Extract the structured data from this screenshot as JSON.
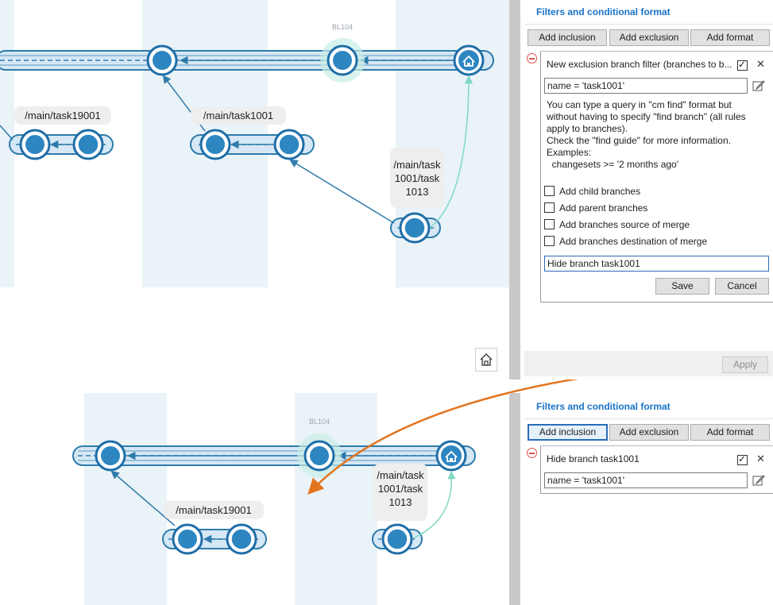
{
  "colors": {
    "accent": "#1a73c8",
    "node": "#2e86c1",
    "node_dark": "#1f6ea8",
    "lane": "#eaf3f8",
    "callout_arrow": "#e3741e",
    "merge_line": "#8fe0cf"
  },
  "graph_top": {
    "label_bl": "BL104",
    "branch_labels": [
      "/main/task19001",
      "/main/task1001",
      "/main/task\n1001/task\n1013"
    ]
  },
  "graph_bottom": {
    "label_bl": "BL104",
    "branch_labels": [
      "/main/task19001",
      "/main/task\n1001/task\n1013"
    ]
  },
  "panel_top": {
    "title": "Filters and conditional format",
    "buttons": {
      "inclusion": "Add inclusion",
      "exclusion": "Add exclusion",
      "format": "Add format"
    },
    "filter": {
      "header": "New exclusion branch filter (branches to b...",
      "query": "name = 'task1001'",
      "help_lines": [
        "You can type a query in \"cm find\" format but",
        "without having to specify \"find branch\" (all rules",
        "apply to branches).",
        "Check the \"find guide\" for more information.",
        "Examples:",
        "  changesets >= '2 months ago'"
      ],
      "options": [
        "Add child branches",
        "Add parent branches",
        "Add branches source of merge",
        "Add branches destination of merge"
      ],
      "name_value": "Hide branch task1001",
      "save": "Save",
      "cancel": "Cancel"
    },
    "apply": "Apply"
  },
  "panel_bottom": {
    "title": "Filters and conditional format",
    "buttons": {
      "inclusion": "Add inclusion",
      "exclusion": "Add exclusion",
      "format": "Add format"
    },
    "filter": {
      "header": "Hide branch task1001",
      "query": "name = 'task1001'"
    }
  },
  "icons": {
    "home": "home-icon",
    "remove": "minus-circle-icon",
    "edit": "edit-icon",
    "close": "close-icon",
    "check": "checkbox-icon"
  }
}
